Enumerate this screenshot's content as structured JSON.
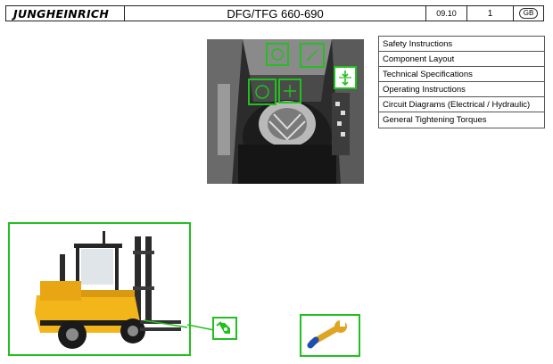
{
  "header": {
    "brand": "JUNGHEINRICH",
    "title": "DFG/TFG 660-690",
    "date": "09.10",
    "page": "1",
    "language": "GB"
  },
  "menu": {
    "items": [
      "Safety Instructions",
      "Component Layout",
      "Technical Specifications",
      "Operating Instructions",
      "Circuit Diagrams (Electrical / Hydraulic)",
      "General Tightening Torques"
    ]
  },
  "colors": {
    "highlight": "#22c01e",
    "truck_body": "#f2b51a"
  },
  "icons": [
    "fuel-pump-icon",
    "wrench-icon"
  ]
}
